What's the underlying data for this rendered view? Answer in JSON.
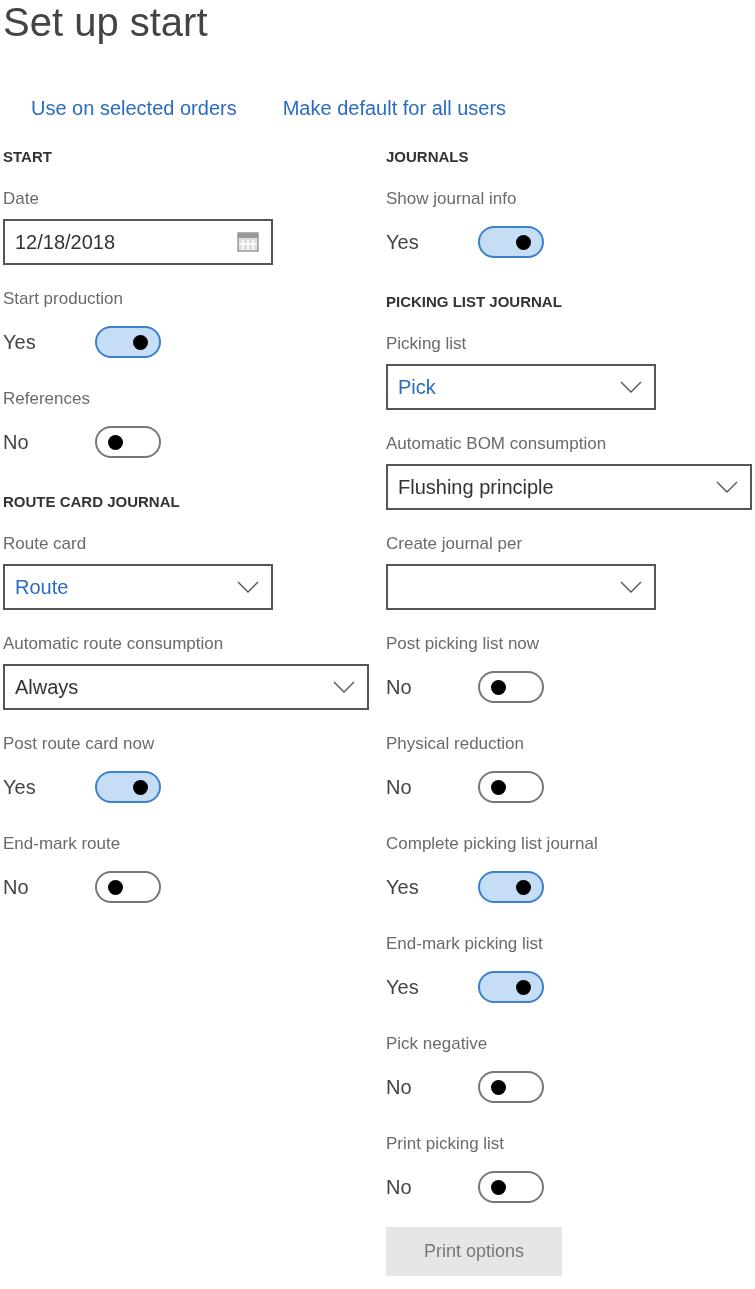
{
  "title": "Set up start",
  "actions": [
    {
      "label": "Use on selected orders"
    },
    {
      "label": "Make default for all users"
    }
  ],
  "columns": [
    {
      "items": [
        {
          "kind": "heading",
          "label": "START"
        },
        {
          "kind": "date",
          "label": "Date",
          "value": "12/18/2018"
        },
        {
          "kind": "toggle",
          "label": "Start production",
          "value": "Yes",
          "on": true
        },
        {
          "kind": "toggle",
          "label": "References",
          "value": "No",
          "on": false
        },
        {
          "kind": "heading",
          "label": "ROUTE CARD JOURNAL"
        },
        {
          "kind": "lookup",
          "label": "Route card",
          "value": "Route"
        },
        {
          "kind": "dropdown-wide",
          "label": "Automatic route consumption",
          "value": "Always"
        },
        {
          "kind": "toggle",
          "label": "Post route card now",
          "value": "Yes",
          "on": true
        },
        {
          "kind": "toggle",
          "label": "End-mark route",
          "value": "No",
          "on": false
        }
      ]
    },
    {
      "items": [
        {
          "kind": "heading",
          "label": "JOURNALS"
        },
        {
          "kind": "toggle",
          "label": "Show journal info",
          "value": "Yes",
          "on": true
        },
        {
          "kind": "heading",
          "label": "PICKING LIST JOURNAL"
        },
        {
          "kind": "lookup",
          "label": "Picking list",
          "value": "Pick"
        },
        {
          "kind": "dropdown-wide",
          "label": "Automatic BOM consumption",
          "value": "Flushing principle"
        },
        {
          "kind": "dropdown",
          "label": "Create journal per"
        },
        {
          "kind": "toggle",
          "label": "Post picking list now",
          "value": "No",
          "on": false
        },
        {
          "kind": "toggle",
          "label": "Physical reduction",
          "value": "No",
          "on": false
        },
        {
          "kind": "toggle",
          "label": "Complete picking list journal",
          "value": "Yes",
          "on": true
        },
        {
          "kind": "toggle",
          "label": "End-mark picking list",
          "value": "Yes",
          "on": true
        },
        {
          "kind": "toggle",
          "label": "Pick negative",
          "value": "No",
          "on": false
        },
        {
          "kind": "toggle",
          "label": "Print picking list",
          "value": "No",
          "on": false
        },
        {
          "kind": "button",
          "label": "Print options",
          "disabled": true
        }
      ]
    }
  ]
}
